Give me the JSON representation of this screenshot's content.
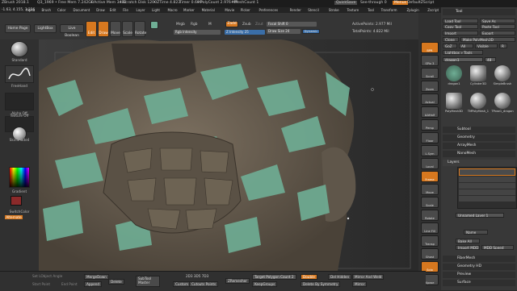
{
  "menubar": {
    "app_title": "ZBrush 2018.1",
    "file": "Q3_1969",
    "free_mem": "• Free Mem 7.242GB",
    "active_mem": "• Active Mem 3480",
    "scratch_disk": "• Scratch Disk 1200",
    "ztime": "• ZTime 4.823",
    "timer": "Timer 0.609",
    "poly_count": "• PolyCount 2.976 MP",
    "mesh_count": "• MeshCount 1",
    "menus": [
      "Alpha",
      "Brush",
      "Color",
      "Document",
      "Draw",
      "Edit",
      "File",
      "Layer",
      "Light",
      "Macro",
      "Marker",
      "Material",
      "Movie",
      "Picker",
      "Preferences",
      "Render",
      "Stencil",
      "Stroke",
      "Texture",
      "Tool",
      "Transform",
      "Zplugin",
      "Zscript"
    ],
    "quicksave": "QuickSave",
    "seethrough": "See-through 0",
    "menus_btn": "Menus",
    "default_zscript": "DefaultZScript"
  },
  "inforow": {
    "coords": "-1.63, 4.155, 3.226"
  },
  "shelf": {
    "home_page": "Home Page",
    "lightbox": "LightBox",
    "live_boolean": "Live Boolean",
    "edit": "Edit",
    "draw": "Draw",
    "move": "Move",
    "scale": "Scale",
    "rotate": "Rotate",
    "mrgb": "Mrgb",
    "rgb": "Rgb",
    "m": "M",
    "rgb_intensity": "Rgb Intensity",
    "zadd": "Zadd",
    "zsub": "Zsub",
    "zcut": "Zcut",
    "z_intensity": "Z Intensity 25",
    "focal_shift": "Focal Shift 0",
    "draw_size": "Draw Size 24",
    "dynamic": "Dynamic",
    "active_points": "ActivePoints: 2.977 Mil",
    "total_points": "TotalPoints: 4.822 Mil"
  },
  "leftshelf": {
    "standard": "Standard",
    "freehand": "FreeHand",
    "alpha_off": "Alpha Off",
    "texture_off": "Texture Off",
    "skinshade": "SkinShade4",
    "gradient": "Gradient",
    "switch_color": "SwitchColor",
    "alternate": "Alternate"
  },
  "rtray": {
    "buttons": [
      "BPR",
      "SPix 3",
      "Scroll",
      "Zoom",
      "Actual",
      "AAHalf",
      "Persp",
      "Floor",
      "L.Sym",
      "Local",
      "Frame",
      "Move",
      "Scale",
      "Rotate",
      "Line Fill",
      "Transp",
      "Ghost",
      "Solo",
      "Xpose"
    ]
  },
  "tool": {
    "title": "Tool",
    "load_tool": "Load Tool",
    "save_as": "Save As",
    "copy_tool": "Copy Tool",
    "paste_tool": "Paste Tool",
    "import": "Import",
    "export": "Export",
    "clone": "Clone",
    "make_polymesh": "Make PolyMesh3D",
    "goz": "GoZ",
    "all": "All",
    "visible": "Visible",
    "r": "R",
    "lightbox_tools": "Lightbox » Tools",
    "current_tool": "dragon1",
    "current_tool_value": "48",
    "thumb_labels": [
      "dragon1",
      "Cylinder3D",
      "SimpleBrush",
      "PolyMesh3D",
      "TMPolyMesh_1",
      "TPose1_dragon"
    ],
    "subtool": "Subtool",
    "geometry": "Geometry",
    "arraymesh": "ArrayMesh",
    "nanomesh": "NanoMesh",
    "layers": "Layers",
    "unnamed_layer": "Unnamed Layer 1",
    "name": "Name",
    "bake_all": "Bake All",
    "import_mdd": "Import MDD",
    "mdd_speed": "MDD Speed",
    "fibermesh": "FiberMesh",
    "geometry_hd": "Geometry HD",
    "preview": "Preview",
    "surface": "Surface"
  },
  "bottom": {
    "set_lobject": "Set LObject Angle",
    "start_point": "Start Point",
    "end_point": "End Point",
    "merge_down": "MergeDown",
    "append": "Append",
    "delete": "Delete",
    "subtool_master": "SubTool Master",
    "res_values": "2D3 3D5 7D3",
    "custom": "Custom",
    "cutouts": "Cutouts Points",
    "zremesher": "ZRemesher",
    "target_polycount": "Target Polygon Count 2",
    "keep_groups": "KeepGroups",
    "double": "Double",
    "del_hidden": "Del Hidden",
    "mirror_weld": "Mirror And Weld",
    "delete_by_symmetry": "Delete By Symmetry",
    "mirror": "Mirror"
  },
  "colors": {
    "accent_orange": "#d7781f",
    "skin_green": "#6fae95",
    "skin_brown": "#6e6353",
    "panel_dark": "#303030"
  }
}
